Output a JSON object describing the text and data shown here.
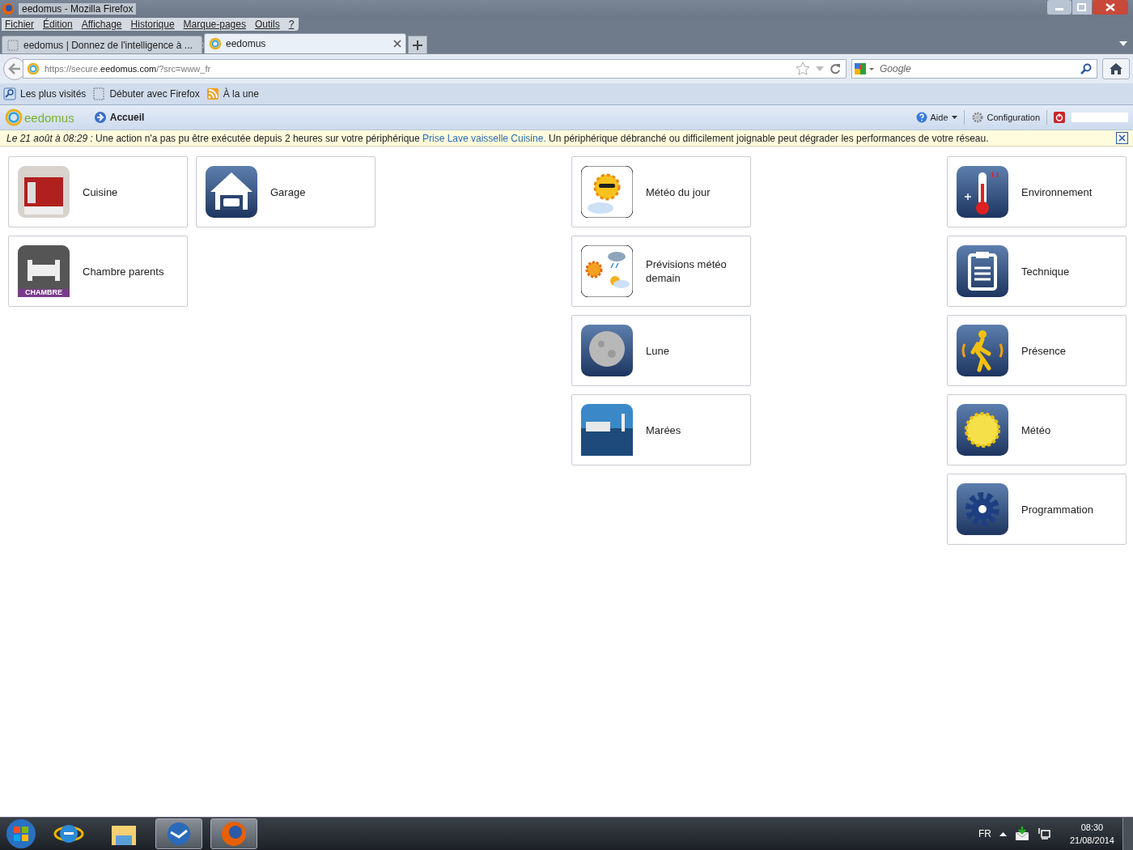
{
  "window": {
    "title": "eedomus - Mozilla Firefox"
  },
  "menu": [
    "Fichier",
    "Édition",
    "Affichage",
    "Historique",
    "Marque-pages",
    "Outils",
    "?"
  ],
  "tabs": [
    {
      "label": "eedomus | Donnez de l'intelligence à ...",
      "selected": false
    },
    {
      "label": "eedomus",
      "selected": true
    }
  ],
  "address": {
    "prefix": "https://secure.",
    "domain": "eedomus.com",
    "suffix": "/?src=www_fr"
  },
  "search": {
    "placeholder": "Google"
  },
  "bookmarks": [
    {
      "label": "Les plus visités",
      "kind": "search"
    },
    {
      "label": "Débuter avec Firefox",
      "kind": "page"
    },
    {
      "label": "À la une",
      "kind": "feed"
    }
  ],
  "app": {
    "logo": "eedomus",
    "home": "Accueil",
    "help": "Aide",
    "config": "Configuration"
  },
  "alert": {
    "date": "Le 21 août à 08:29 :",
    "before": "Une action n'a pas pu être exécutée depuis 2 heures sur votre périphérique",
    "link": "Prise Lave vaisselle Cuisine.",
    "after": "Un périphérique débranché ou difficilement joignable peut dégrader les performances de votre réseau."
  },
  "tile_groups": [
    {
      "kind": "left",
      "tiles": [
        {
          "label": "Cuisine",
          "kind": "kitchen"
        },
        {
          "label": "Garage",
          "kind": "garage"
        },
        {
          "label": "Chambre parents",
          "kind": "bedroom",
          "badge": "CHAMBRE"
        }
      ]
    },
    {
      "kind": "center",
      "tiles": [
        {
          "label": "Météo du jour",
          "kind": "sun-cartoon"
        },
        {
          "label": "Prévisions météo demain",
          "kind": "forecast"
        },
        {
          "label": "Lune",
          "kind": "moon"
        },
        {
          "label": "Marées",
          "kind": "harbor"
        }
      ]
    },
    {
      "kind": "right",
      "tiles": [
        {
          "label": "Environnement",
          "kind": "thermometer"
        },
        {
          "label": "Technique",
          "kind": "clipboard"
        },
        {
          "label": "Présence",
          "kind": "walker"
        },
        {
          "label": "Météo",
          "kind": "sun"
        },
        {
          "label": "Programmation",
          "kind": "gear"
        }
      ]
    }
  ],
  "taskbar": {
    "language": "FR",
    "time": "08:30",
    "date": "21/08/2014"
  }
}
